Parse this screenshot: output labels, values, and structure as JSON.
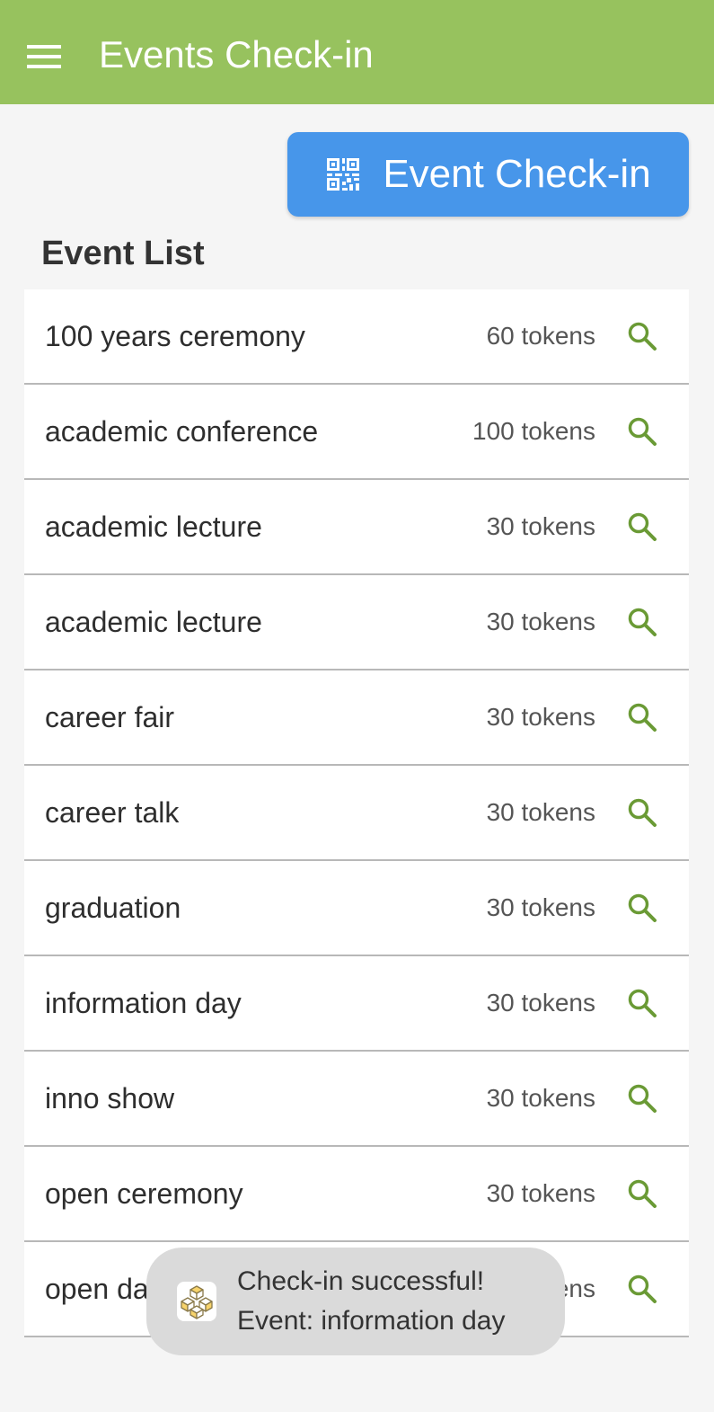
{
  "app_bar": {
    "title": "Events Check-in",
    "menu_icon": "hamburger-menu-icon",
    "background": "#97c25e"
  },
  "checkin_button": {
    "label": "Event Check-in",
    "icon": "qr-code-icon",
    "background": "#4796ea"
  },
  "event_list": {
    "title": "Event List",
    "action_icon": "search-icon",
    "action_icon_color": "#6a9a35",
    "items": [
      {
        "name": "100 years ceremony",
        "tokens": "60 tokens"
      },
      {
        "name": "academic conference",
        "tokens": "100 tokens"
      },
      {
        "name": "academic lecture",
        "tokens": "30 tokens"
      },
      {
        "name": "academic lecture",
        "tokens": "30 tokens"
      },
      {
        "name": "career fair",
        "tokens": "30 tokens"
      },
      {
        "name": "career talk",
        "tokens": "30 tokens"
      },
      {
        "name": "graduation",
        "tokens": "30 tokens"
      },
      {
        "name": "information day",
        "tokens": "30 tokens"
      },
      {
        "name": "inno show",
        "tokens": "30 tokens"
      },
      {
        "name": "open ceremony",
        "tokens": "30 tokens"
      },
      {
        "name": "open day",
        "tokens": "30 tokens"
      }
    ]
  },
  "toast": {
    "line1": "Check-in successful!",
    "line2": "Event: information day",
    "icon": "app-cubes-icon"
  }
}
